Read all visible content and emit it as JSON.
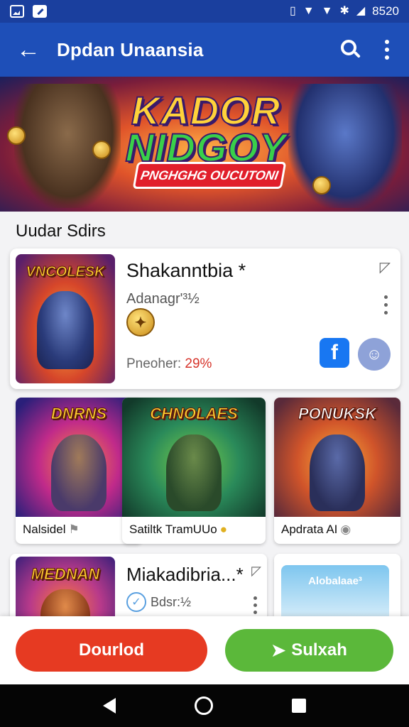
{
  "status_bar": {
    "time": "8520",
    "icons": [
      "image-icon",
      "edit-icon",
      "vibrate-icon",
      "wifi-icon",
      "wifi-icon",
      "bluetooth-icon",
      "signal-icon"
    ],
    "color": "#1a3f9e"
  },
  "app_bar": {
    "title": "Dpdan Unaansia",
    "back_icon": "back-arrow-icon",
    "search_icon": "search-icon",
    "more_icon": "more-vert-icon",
    "color": "#1e4fb8"
  },
  "hero_banner": {
    "title_line1": "KADOR",
    "title_line2": "NIDGOY",
    "ribbon": "PNGHGHG OUCUTONI"
  },
  "section_title": "Uudar Sdirs",
  "featured": {
    "thumb_title": "VNCOLESK",
    "title": "Shakanntbia *",
    "subtitle": "Adanagr'³½",
    "progress_label": "Pneoher: ",
    "progress_value": "29%",
    "share_icon": "share-icon",
    "facebook_icon": "facebook-icon",
    "chat_icon": "chat-icon"
  },
  "grid": [
    {
      "thumb_title": "DNRNS",
      "label": "Nalsidel",
      "symbol": "⚑"
    },
    {
      "thumb_title": "CHNOLAES",
      "label": "Satiltk TramUUo",
      "symbol": "●"
    },
    {
      "thumb_title": "PONUKSK",
      "label": "Apdrata AI",
      "symbol": "◉"
    }
  ],
  "row3": {
    "thumb_title": "MEDNAN",
    "title": "Miakadibria...*",
    "subtitle": "Bdsr:½",
    "banner_text": "Alobalaae³"
  },
  "actions": {
    "download_label": "Dourlod",
    "submit_label": "Sulxah",
    "download_color": "#e63a22",
    "submit_color": "#5bb83a"
  },
  "nav": {
    "back": "nav-back-icon",
    "home": "nav-home-icon",
    "recents": "nav-recents-icon"
  }
}
